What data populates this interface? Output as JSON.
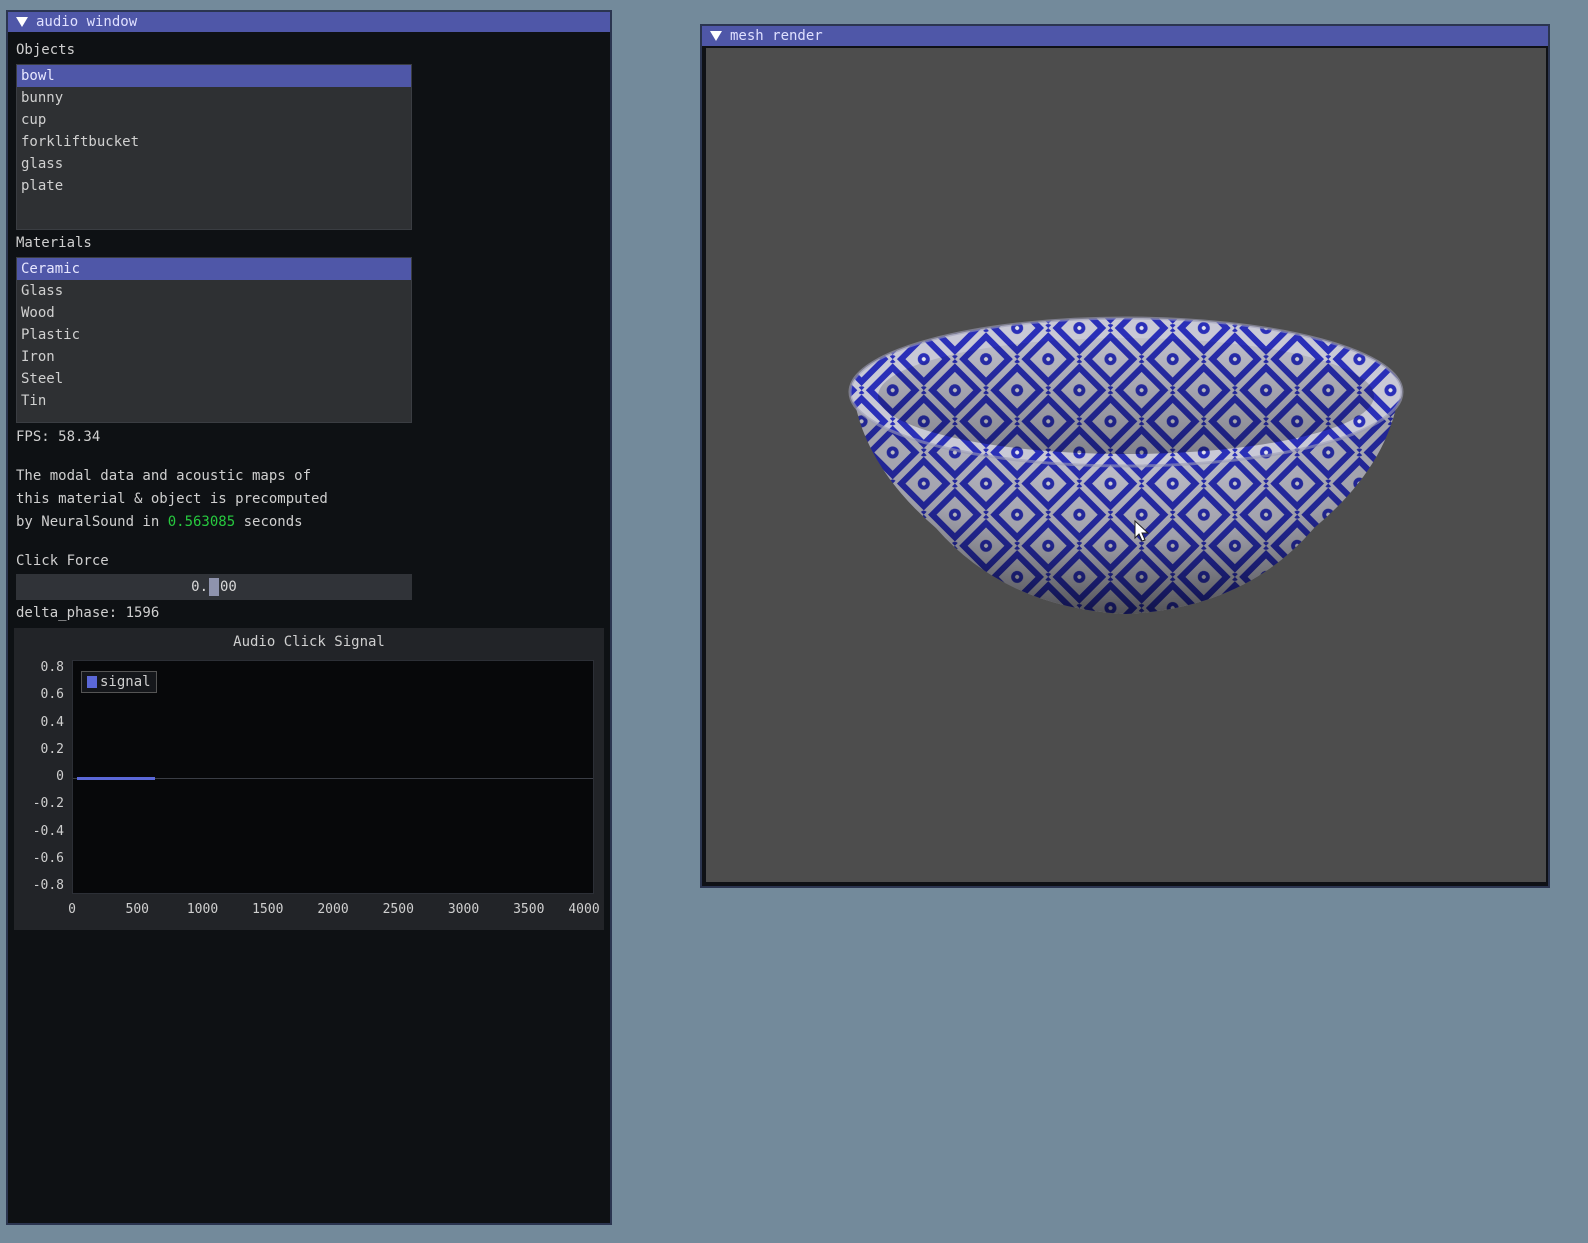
{
  "audio_window": {
    "title": "audio window",
    "objects_label": "Objects",
    "objects": [
      "bowl",
      "bunny",
      "cup",
      "forkliftbucket",
      "glass",
      "plate"
    ],
    "selected_object": "bowl",
    "materials_label": "Materials",
    "materials": [
      "Ceramic",
      "Glass",
      "Wood",
      "Plastic",
      "Iron",
      "Steel",
      "Tin"
    ],
    "selected_material": "Ceramic",
    "fps": "FPS: 58.34",
    "info_line1": "The modal data and acoustic maps of",
    "info_line2": "this material & object is precomputed",
    "info_line3_prefix": "by NeuralSound in ",
    "info_time": "0.563085",
    "info_line3_suffix": " seconds",
    "click_force_label": "Click Force",
    "click_force_value_a": "0.",
    "click_force_value_b": "00",
    "delta_phase": "delta_phase: 1596"
  },
  "chart_data": {
    "type": "line",
    "title": "Audio Click Signal",
    "series": [
      {
        "name": "signal",
        "x": [
          0,
          600
        ],
        "values": [
          0,
          0
        ]
      }
    ],
    "ylim": [
      -0.8,
      0.8
    ],
    "xlim": [
      0,
      4000
    ],
    "yticks": [
      "0.8",
      "0.6",
      "0.4",
      "0.2",
      "0",
      "-0.2",
      "-0.4",
      "-0.6",
      "-0.8"
    ],
    "xticks": [
      "0",
      "500",
      "1000",
      "1500",
      "2000",
      "2500",
      "3000",
      "3500",
      "4000"
    ],
    "legend": "top-left"
  },
  "mesh_window": {
    "title": "mesh render",
    "object": "bowl",
    "pattern_color": "#2a2fb8"
  }
}
